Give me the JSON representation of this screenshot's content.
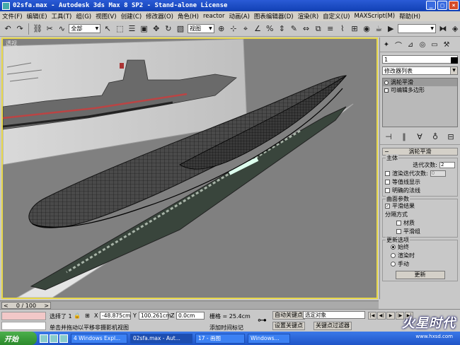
{
  "window": {
    "title": "02sfa.max - Autodesk 3ds Max 8 SP2 - Stand-alone License",
    "buttons": {
      "minimize": "_",
      "maximize": "□",
      "close": "×"
    }
  },
  "menu": [
    "文件(F)",
    "编辑(E)",
    "工具(T)",
    "组(G)",
    "视图(V)",
    "创建(C)",
    "修改器(O)",
    "角色(H)",
    "reactor",
    "动画(A)",
    "图表编辑器(D)",
    "渲染(R)",
    "自定义(U)",
    "MAXScript(M)",
    "帮助(H)"
  ],
  "toolbar": {
    "selection_filter": "全部",
    "ref_coord": "视图"
  },
  "viewport": {
    "label": "透视"
  },
  "command_panel": {
    "object_name": "1",
    "modifier_list": "修改器列表",
    "stack": [
      "涡轮平滑",
      "可编辑多边形"
    ],
    "rollout_title": "涡轮平滑",
    "main_group": "主体",
    "iterations_label": "迭代次数:",
    "iterations_value": "2",
    "render_iters_label": "渲染迭代次数:",
    "render_iters_value": "0",
    "isoline_label": "等值线显示",
    "explicit_normals_label": "明确的法线",
    "surface_group": "曲面参数",
    "smooth_result_label": "平滑结果",
    "separate_by": "分隔方式",
    "materials_label": "材质",
    "smoothing_groups_label": "平滑组",
    "update_group": "更新选项",
    "always_label": "始终",
    "when_rendering_label": "渲染时",
    "manually_label": "手动",
    "update_button": "更新"
  },
  "timeline": {
    "frame": "0 / 100"
  },
  "status": {
    "selection": "选择了 1",
    "prompt": "单击并拖动以平移非摄影机视图",
    "x_label": "X",
    "x_value": "-48.875cm",
    "y_label": "Y",
    "y_value": "100.261cm",
    "z_label": "Z",
    "z_value": "0.0cm",
    "grid": "栅格 = 25.4cm",
    "add_time_tag": "添加时间标记",
    "auto_key": "自动关键点",
    "set_key": "设置关键点",
    "selected": "选定对象",
    "key_filters": "关键点过滤器"
  },
  "taskbar": {
    "start": "开始",
    "tasks": [
      "4 Windows Expl...",
      "02sfa.max - Aut...",
      "17 - 画图",
      "Windows..."
    ]
  },
  "watermark": {
    "text": "火星时代",
    "url": "www.hxsd.com"
  }
}
